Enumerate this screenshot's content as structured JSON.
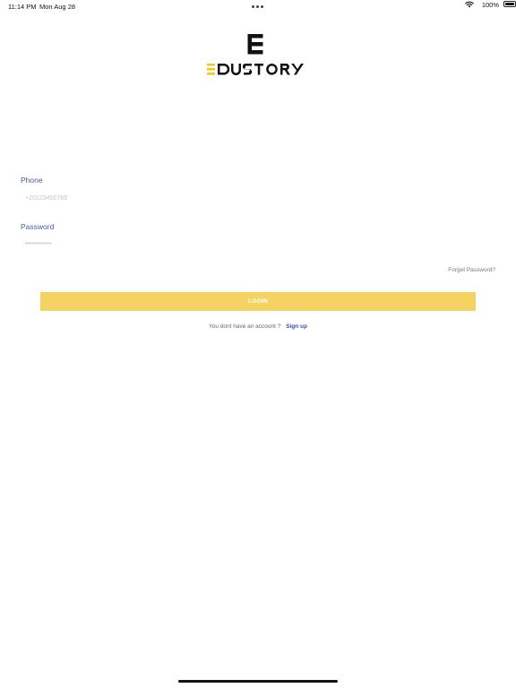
{
  "status_bar": {
    "time": "11:14 PM",
    "date": "Mon Aug 28",
    "battery_percent": "100%",
    "icons": [
      "more-dots-icon",
      "wifi-icon",
      "battery-icon"
    ]
  },
  "logo": {
    "text": "EDUSTORY",
    "colors": {
      "black": "#111111",
      "yellow": "#f5c518"
    }
  },
  "form": {
    "phone": {
      "label": "Phone",
      "placeholder": "+20123456789",
      "value": ""
    },
    "password": {
      "label": "Password",
      "placeholder": "••••••••••••",
      "value": ""
    },
    "forgot_label": "Forget Password?",
    "login_label": "LOGIN",
    "signup_prompt": "You dont have an account ?",
    "signup_label": "Sign up"
  },
  "colors": {
    "label": "#4a59a6",
    "button": "#f5d361",
    "link": "#3a4fb0"
  }
}
